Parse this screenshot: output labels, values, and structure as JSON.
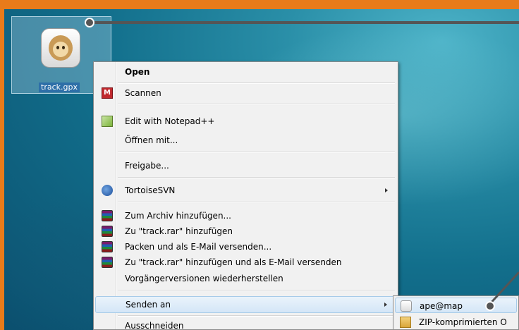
{
  "desktop": {
    "icon_label": "track.gpx"
  },
  "context_menu": {
    "items": [
      {
        "label": "Open"
      },
      {
        "label": "Scannen"
      },
      {
        "label": "Edit with Notepad++"
      },
      {
        "label": "Öffnen mit..."
      },
      {
        "label": "Freigabe..."
      },
      {
        "label": "TortoiseSVN"
      },
      {
        "label": "Zum Archiv hinzufügen..."
      },
      {
        "label": "Zu \"track.rar\" hinzufügen"
      },
      {
        "label": "Packen und als E-Mail versenden..."
      },
      {
        "label": "Zu \"track.rar\" hinzufügen und als E-Mail versenden"
      },
      {
        "label": "Vorgängerversionen wiederherstellen"
      },
      {
        "label": "Senden an"
      },
      {
        "label": "Ausschneiden"
      }
    ]
  },
  "send_to_submenu": {
    "items": [
      {
        "label": "ape@map"
      },
      {
        "label": "ZIP-komprimierten O"
      }
    ]
  },
  "colors": {
    "frame_border": "#e87b1a",
    "highlight": "#d4e6f7",
    "leader_line": "#555555"
  }
}
